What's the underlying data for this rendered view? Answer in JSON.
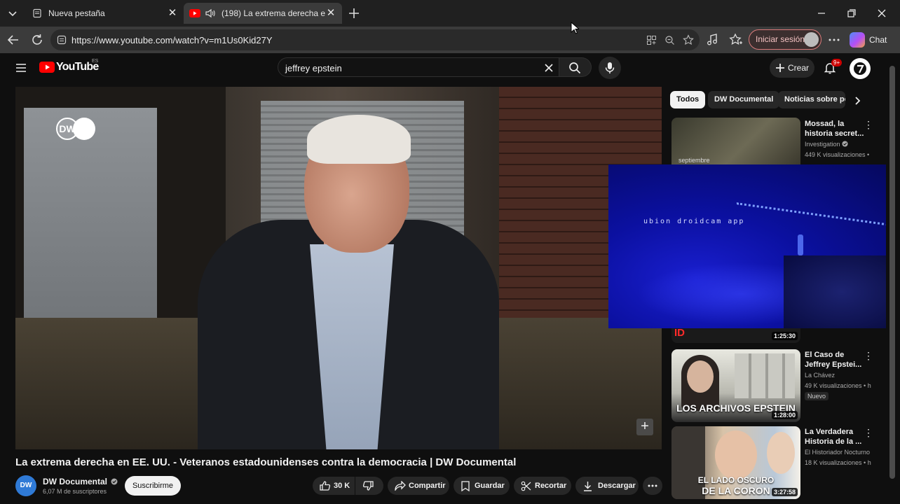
{
  "browser": {
    "tabs": [
      {
        "title": "Nueva pestaña",
        "icon": "page-icon"
      },
      {
        "title": "(198) La extrema derecha en E",
        "icon": "youtube-icon",
        "audio": true
      }
    ],
    "url": "https://www.youtube.com/watch?v=m1Us0Kid27Y",
    "signin_label": "Iniciar sesión",
    "chat_label": "Chat"
  },
  "youtube": {
    "logo_text": "YouTube",
    "country_code": "ES",
    "search_value": "jeffrey epstein",
    "create_label": "Crear",
    "notification_count": "9+"
  },
  "video": {
    "channel_watermark": "DW",
    "title": "La extrema derecha en EE. UU. - Veteranos estadounidenses contra la democracia | DW Documental",
    "channel_name": "DW Documental",
    "channel_avatar_text": "DW",
    "subscribers": "6,07 M de suscriptores",
    "subscribe_label": "Suscribirme",
    "likes": "30 K",
    "share_label": "Compartir",
    "save_label": "Guardar",
    "clip_label": "Recortar",
    "download_label": "Descargar"
  },
  "sidebar": {
    "chips": [
      "Todos",
      "DW Documental",
      "Noticias sobre po"
    ],
    "videos": [
      {
        "title": "Mossad, la historia secret...",
        "channel": "Investigation",
        "verified": true,
        "meta": "449 K visualizaciones •",
        "thumb_caption": "septiembre"
      },
      {
        "duration": "1:25:30"
      },
      {
        "title": "El Caso de Jeffrey Epstei...",
        "channel": "La Chávez",
        "meta": "49 K visualizaciones • h",
        "badge": "Nuevo",
        "duration": "1:28:00",
        "thumb_caption": "LOS ARCHIVOS EPSTEIN"
      },
      {
        "title": "La Verdadera Historia de la ...",
        "channel": "El Historiador Nocturno",
        "meta": "18 K visualizaciones • h",
        "duration": "3:27:58",
        "thumb_caption_1": "EL LADO OSCURO",
        "thumb_caption_2": "DE LA CORON"
      }
    ]
  },
  "overlay": {
    "watermark": "ubion droidcam app"
  },
  "colors": {
    "youtube_red": "#ff0000",
    "overlay_blue": "#0b10a0"
  }
}
